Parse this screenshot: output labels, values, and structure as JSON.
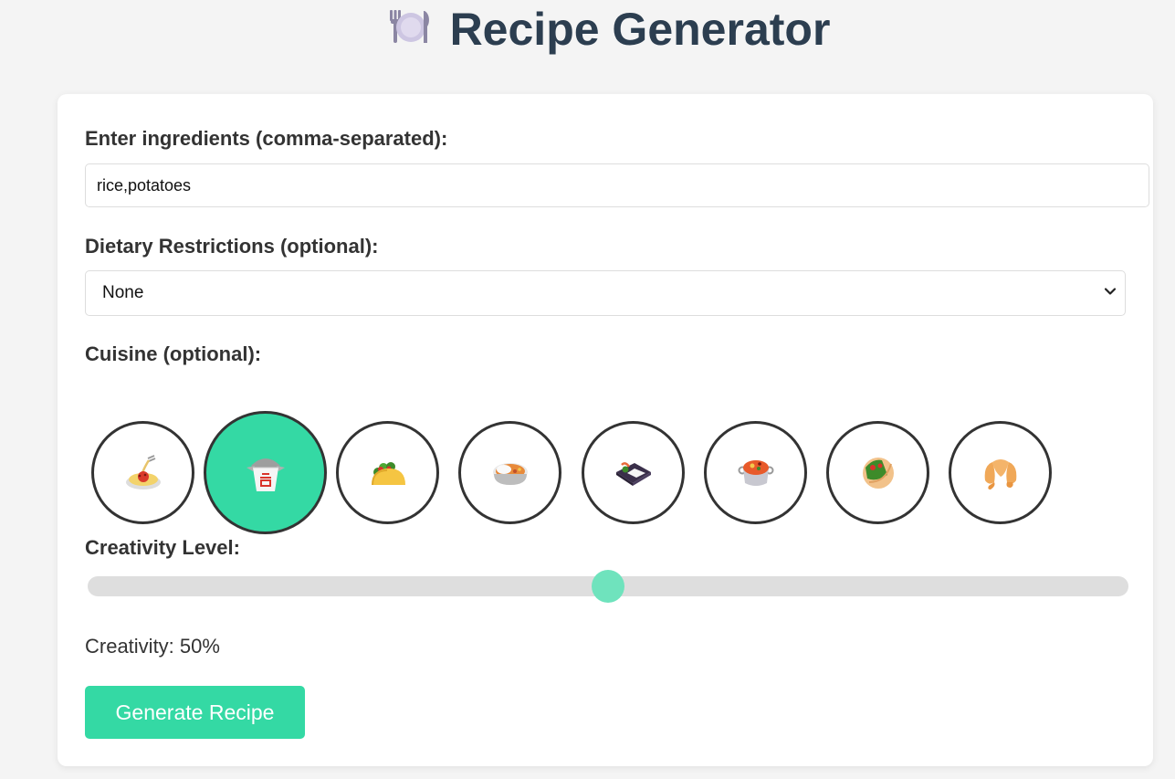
{
  "header": {
    "title": "Recipe Generator",
    "icon": "plate-with-cutlery-icon"
  },
  "form": {
    "ingredients_label": "Enter ingredients (comma-separated):",
    "ingredients_value": "rice,potatoes",
    "dietary_label": "Dietary Restrictions (optional):",
    "dietary_selected": "None",
    "cuisine_label": "Cuisine (optional):",
    "cuisines": [
      {
        "icon": "spaghetti-icon",
        "selected": false
      },
      {
        "icon": "takeout-box-icon",
        "selected": true
      },
      {
        "icon": "taco-icon",
        "selected": false
      },
      {
        "icon": "curry-rice-icon",
        "selected": false
      },
      {
        "icon": "bento-box-icon",
        "selected": false
      },
      {
        "icon": "pot-of-food-icon",
        "selected": false
      },
      {
        "icon": "stuffed-flatbread-icon",
        "selected": false
      },
      {
        "icon": "croissant-icon",
        "selected": false
      }
    ],
    "creativity_label": "Creativity Level:",
    "creativity_value": 50,
    "creativity_text": "Creativity: 50%",
    "generate_label": "Generate Recipe"
  },
  "colors": {
    "accent": "#34d9a4",
    "title": "#2c3e50",
    "background": "#f4f4f4"
  }
}
